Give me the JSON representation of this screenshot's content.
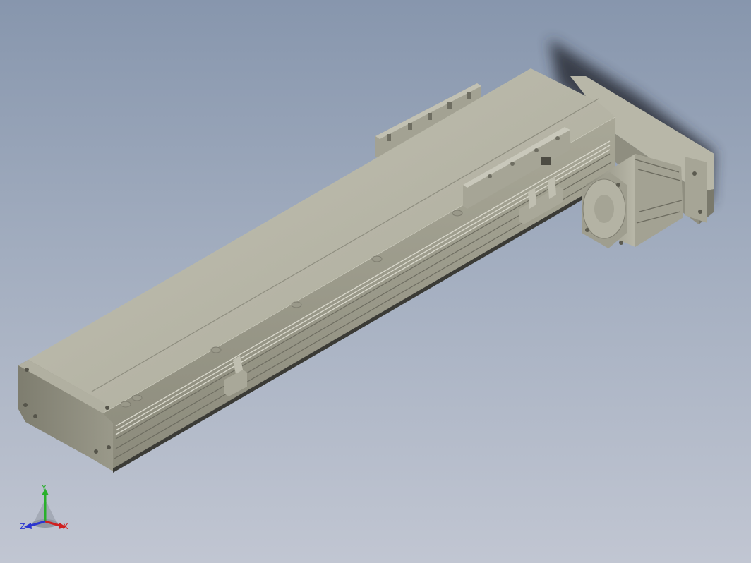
{
  "scene": {
    "background_top": "#8796ad",
    "background_bottom": "#c1c6d2",
    "model_color": "#b9b7a8"
  },
  "triad": {
    "x_label": "X",
    "y_label": "Y",
    "z_label": "Z",
    "x_color": "#d02020",
    "y_color": "#29b02b",
    "z_color": "#2b35d0"
  }
}
